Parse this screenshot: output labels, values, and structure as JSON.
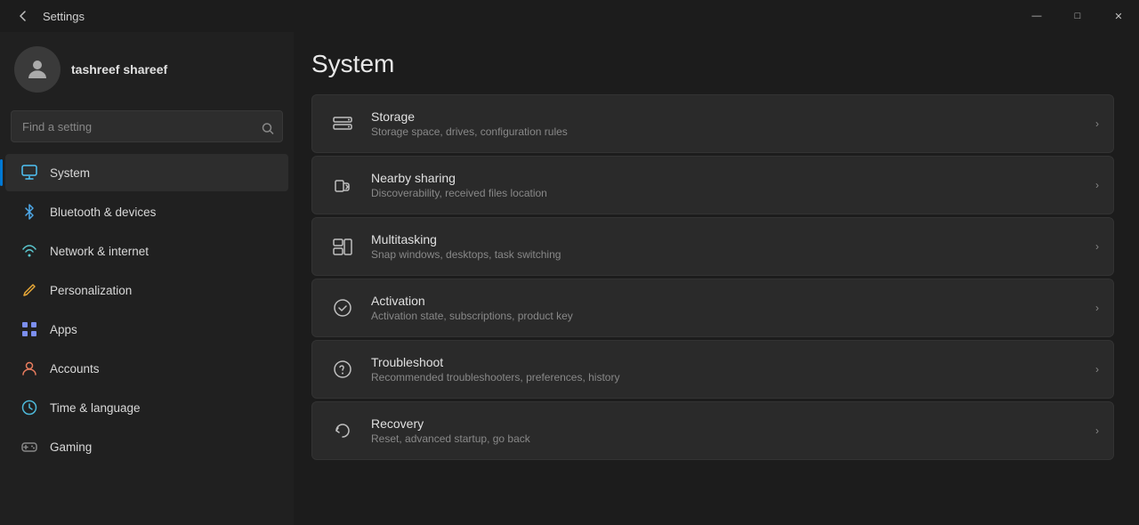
{
  "window": {
    "title": "Settings",
    "controls": {
      "minimize": "—",
      "maximize": "□",
      "close": "✕"
    }
  },
  "user": {
    "name": "tashreef shareef"
  },
  "search": {
    "placeholder": "Find a setting"
  },
  "nav": {
    "items": [
      {
        "id": "system",
        "label": "System",
        "icon": "system",
        "active": true
      },
      {
        "id": "bluetooth",
        "label": "Bluetooth & devices",
        "icon": "bluetooth",
        "active": false
      },
      {
        "id": "network",
        "label": "Network & internet",
        "icon": "network",
        "active": false
      },
      {
        "id": "personalization",
        "label": "Personalization",
        "icon": "personalization",
        "active": false
      },
      {
        "id": "apps",
        "label": "Apps",
        "icon": "apps",
        "active": false
      },
      {
        "id": "accounts",
        "label": "Accounts",
        "icon": "accounts",
        "active": false
      },
      {
        "id": "time",
        "label": "Time & language",
        "icon": "time",
        "active": false
      },
      {
        "id": "gaming",
        "label": "Gaming",
        "icon": "gaming",
        "active": false
      }
    ]
  },
  "main": {
    "title": "System",
    "settings": [
      {
        "id": "storage",
        "title": "Storage",
        "desc": "Storage space, drives, configuration rules",
        "icon": "storage"
      },
      {
        "id": "nearby-sharing",
        "title": "Nearby sharing",
        "desc": "Discoverability, received files location",
        "icon": "nearby"
      },
      {
        "id": "multitasking",
        "title": "Multitasking",
        "desc": "Snap windows, desktops, task switching",
        "icon": "multitasking"
      },
      {
        "id": "activation",
        "title": "Activation",
        "desc": "Activation state, subscriptions, product key",
        "icon": "activation"
      },
      {
        "id": "troubleshoot",
        "title": "Troubleshoot",
        "desc": "Recommended troubleshooters, preferences, history",
        "icon": "troubleshoot"
      },
      {
        "id": "recovery",
        "title": "Recovery",
        "desc": "Reset, advanced startup, go back",
        "icon": "recovery"
      }
    ]
  }
}
